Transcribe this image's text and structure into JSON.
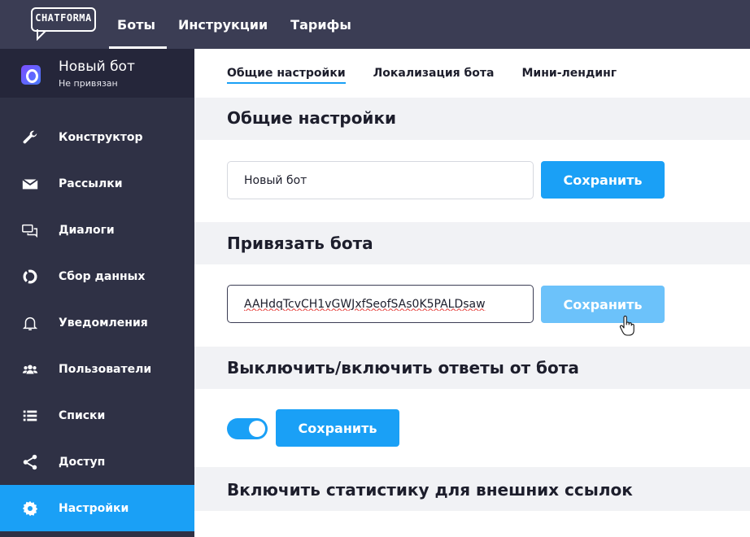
{
  "topbar": {
    "logo_text": "CHATFORMA",
    "nav": [
      {
        "label": "Боты",
        "active": true
      },
      {
        "label": "Инструкции",
        "active": false
      },
      {
        "label": "Тарифы",
        "active": false
      }
    ]
  },
  "bot": {
    "name": "Новый бот",
    "status": "Не привязан"
  },
  "sidebar": {
    "items": [
      {
        "label": "Конструктор",
        "icon": "wrench-icon"
      },
      {
        "label": "Рассылки",
        "icon": "envelope-icon"
      },
      {
        "label": "Диалоги",
        "icon": "chat-bubbles-icon"
      },
      {
        "label": "Сбор данных",
        "icon": "donut-chart-icon"
      },
      {
        "label": "Уведомления",
        "icon": "bell-icon"
      },
      {
        "label": "Пользователи",
        "icon": "users-icon"
      },
      {
        "label": "Списки",
        "icon": "list-icon"
      },
      {
        "label": "Доступ",
        "icon": "share-icon"
      },
      {
        "label": "Настройки",
        "icon": "gear-icon",
        "active": true
      }
    ]
  },
  "tabs": [
    {
      "label": "Общие настройки",
      "active": true
    },
    {
      "label": "Локализация бота",
      "active": false
    },
    {
      "label": "Мини-лендинг",
      "active": false
    }
  ],
  "sections": {
    "general": {
      "title": "Общие настройки",
      "input_value": "Новый бот",
      "save_label": "Сохранить"
    },
    "bind": {
      "title": "Привязать бота",
      "input_value": "AAHdqTcvCH1vGWJxfSeofSAs0K5PALDsaw",
      "save_label": "Сохранить"
    },
    "toggle": {
      "title": "Выключить/включить ответы от бота",
      "enabled": true,
      "save_label": "Сохранить"
    },
    "stats": {
      "title": "Включить статистику для внешних ссылок"
    }
  },
  "colors": {
    "topbar": "#3b3d54",
    "sidebar": "#2f3145",
    "accent": "#1aa0f6",
    "accent_light": "#6cc2fa",
    "section_bg": "#f1f2f5"
  }
}
